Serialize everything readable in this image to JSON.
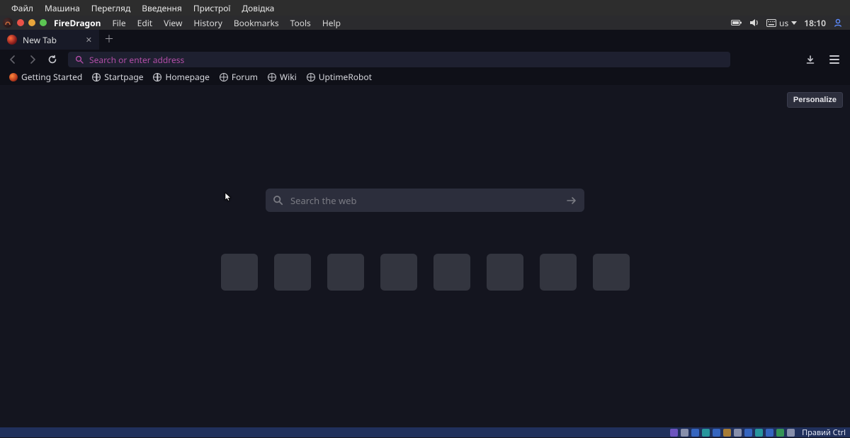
{
  "vm_menu": [
    "Файл",
    "Машина",
    "Перегляд",
    "Введення",
    "Пристрої",
    "Довідка"
  ],
  "titlebar": {
    "app_name": "FireDragon",
    "menu": [
      "File",
      "Edit",
      "View",
      "History",
      "Bookmarks",
      "Tools",
      "Help"
    ],
    "kbd_layout": "us",
    "clock": "18:10"
  },
  "tabs": {
    "items": [
      {
        "label": "New Tab"
      }
    ]
  },
  "urlbar": {
    "placeholder": "Search or enter address"
  },
  "bookmarks": {
    "items": [
      {
        "label": "Getting Started",
        "icon": "flame"
      },
      {
        "label": "Startpage",
        "icon": "globe"
      },
      {
        "label": "Homepage",
        "icon": "globe"
      },
      {
        "label": "Forum",
        "icon": "globe"
      },
      {
        "label": "Wiki",
        "icon": "globe"
      },
      {
        "label": "UptimeRobot",
        "icon": "globe"
      }
    ]
  },
  "content": {
    "personalize_label": "Personalize",
    "search_placeholder": "Search the web",
    "tile_count": 8
  },
  "statusbar": {
    "host_key": "Правий Ctrl"
  }
}
